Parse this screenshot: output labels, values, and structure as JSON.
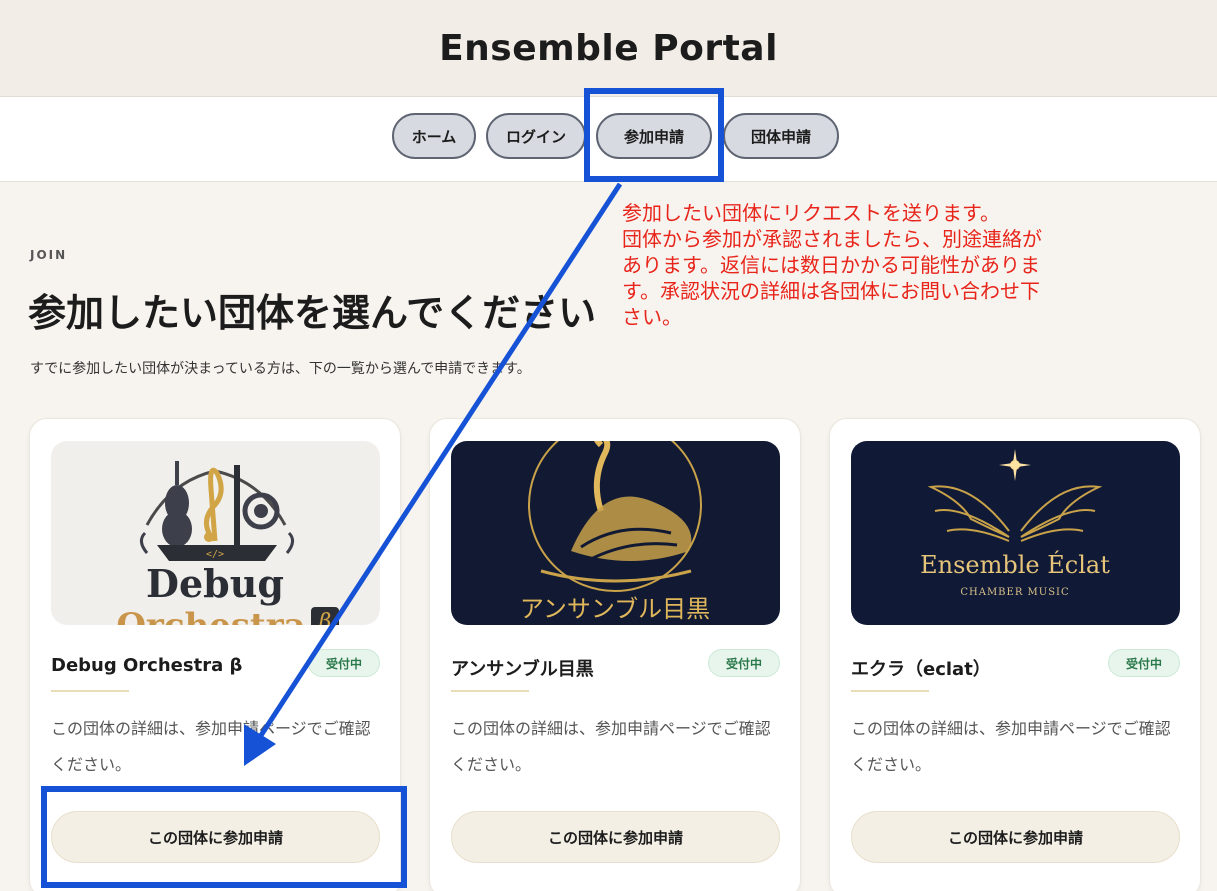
{
  "app": {
    "title": "Ensemble Portal"
  },
  "nav": {
    "items": [
      {
        "label": "ホーム"
      },
      {
        "label": "ログイン"
      },
      {
        "label": "参加申請"
      },
      {
        "label": "団体申請"
      }
    ]
  },
  "hero": {
    "eyebrow": "JOIN",
    "title": "参加したい団体を選んでください",
    "subtitle": "すでに参加したい団体が決まっている方は、下の一覧から選んで申請できます。"
  },
  "annotation": {
    "lines": [
      "参加したい団体にリクエストを送ります。",
      "団体から参加が承認されましたら、別途連絡が",
      "あります。返信には数日かかる可能性がありま",
      "す。承認状況の詳細は各団体にお問い合わせ下",
      "さい。"
    ],
    "color": "#e8251b",
    "highlight_color": "#1552d6"
  },
  "cards": [
    {
      "name": "Debug Orchestra β",
      "status": "受付中",
      "description": "この団体の詳細は、参加申請ページでご確認ください。",
      "button": "この団体に参加申請",
      "logo_text": [
        "Debug",
        "Orchestra",
        "β"
      ],
      "logo_icon": "music-instruments-logo"
    },
    {
      "name": "アンサンブル目黒",
      "status": "受付中",
      "description": "この団体の詳細は、参加申請ページでご確認ください。",
      "button": "この団体に参加申請",
      "logo_text": [
        "アンサンブル目黒"
      ],
      "logo_icon": "swan-logo"
    },
    {
      "name": "エクラ（eclat）",
      "status": "受付中",
      "description": "この団体の詳細は、参加申請ページでご確認ください。",
      "button": "この団体に参加申請",
      "logo_text": [
        "Ensemble Éclat",
        "CHAMBER MUSIC"
      ],
      "logo_icon": "wings-star-logo"
    }
  ]
}
